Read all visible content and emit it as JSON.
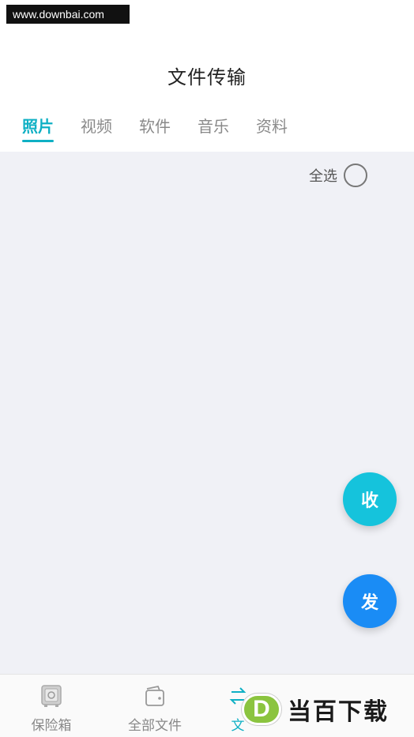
{
  "watermark_top": "www.downbai.com",
  "header": {
    "title": "文件传输"
  },
  "tabs": [
    {
      "label": "照片",
      "active": true
    },
    {
      "label": "视频",
      "active": false
    },
    {
      "label": "软件",
      "active": false
    },
    {
      "label": "音乐",
      "active": false
    },
    {
      "label": "资料",
      "active": false
    }
  ],
  "content": {
    "select_all_label": "全选"
  },
  "fabs": {
    "receive_label": "收",
    "send_label": "发"
  },
  "bottom_nav": [
    {
      "label": "保险箱",
      "icon": "safe-icon",
      "active": false
    },
    {
      "label": "全部文件",
      "icon": "wallet-icon",
      "active": false
    },
    {
      "label": "文",
      "icon": "transfer-icon",
      "active": true
    }
  ],
  "watermark_logo": {
    "letter": "D",
    "text": "当百下载"
  },
  "colors": {
    "accent": "#0fb0c4",
    "receive_fab": "#15c3dc",
    "send_fab": "#1a8cf5",
    "content_bg": "#f0f1f6"
  }
}
